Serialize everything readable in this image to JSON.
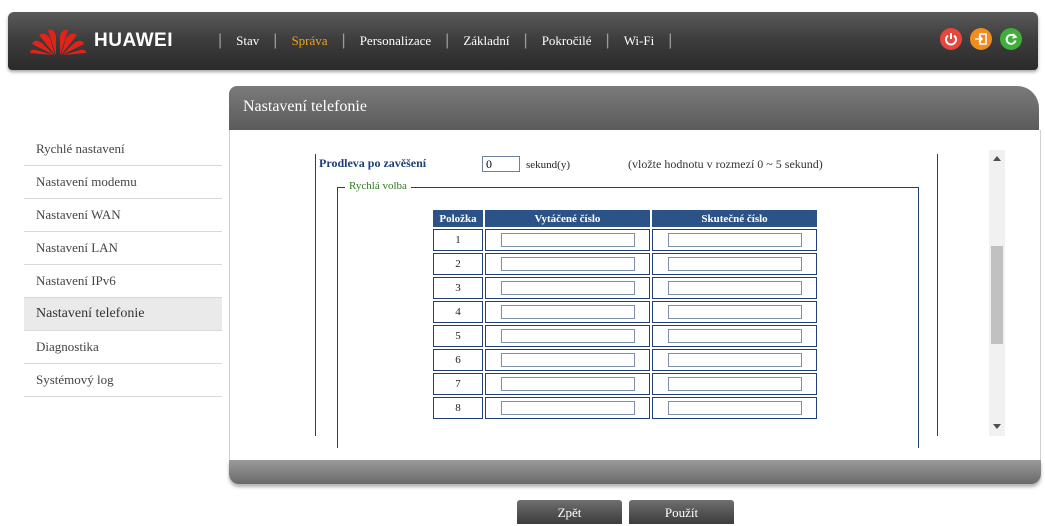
{
  "brand": {
    "name": "HUAWEI",
    "logo_color": "#e2231a"
  },
  "nav": {
    "items": [
      {
        "label": "Stav",
        "active": false
      },
      {
        "label": "Správa",
        "active": true
      },
      {
        "label": "Personalizace",
        "active": false
      },
      {
        "label": "Základní",
        "active": false
      },
      {
        "label": "Pokročilé",
        "active": false
      },
      {
        "label": "Wi-Fi",
        "active": false
      }
    ],
    "accent_color": "#f0a21b"
  },
  "top_icons": [
    {
      "name": "power-icon",
      "color": "#e8453c"
    },
    {
      "name": "logout-icon",
      "color": "#f28c1e"
    },
    {
      "name": "refresh-icon",
      "color": "#3fae3a"
    }
  ],
  "sidebar": {
    "items": [
      {
        "label": "Rychlé nastavení",
        "active": false
      },
      {
        "label": "Nastavení modemu",
        "active": false
      },
      {
        "label": "Nastavení WAN",
        "active": false
      },
      {
        "label": "Nastavení LAN",
        "active": false
      },
      {
        "label": "Nastavení IPv6",
        "active": false
      },
      {
        "label": "Nastavení telefonie",
        "active": true
      },
      {
        "label": "Diagnostika",
        "active": false
      },
      {
        "label": "Systémový log",
        "active": false
      }
    ]
  },
  "panel": {
    "title": "Nastavení telefonie",
    "delay": {
      "label": "Prodleva po zavěšení",
      "value": "0",
      "unit": "sekund(y)",
      "hint": "(vložte hodnotu v rozmezí 0 ~ 5 sekund)"
    },
    "speed_dial": {
      "legend": "Rychlá volba",
      "columns": [
        "Položka",
        "Vytáčené číslo",
        "Skutečné číslo"
      ],
      "rows": [
        {
          "item": "1",
          "dialed": "",
          "actual": ""
        },
        {
          "item": "2",
          "dialed": "",
          "actual": ""
        },
        {
          "item": "3",
          "dialed": "",
          "actual": ""
        },
        {
          "item": "4",
          "dialed": "",
          "actual": ""
        },
        {
          "item": "5",
          "dialed": "",
          "actual": ""
        },
        {
          "item": "6",
          "dialed": "",
          "actual": ""
        },
        {
          "item": "7",
          "dialed": "",
          "actual": ""
        },
        {
          "item": "8",
          "dialed": "",
          "actual": ""
        }
      ]
    }
  },
  "buttons": {
    "back": "Zpět",
    "apply": "Použít"
  }
}
